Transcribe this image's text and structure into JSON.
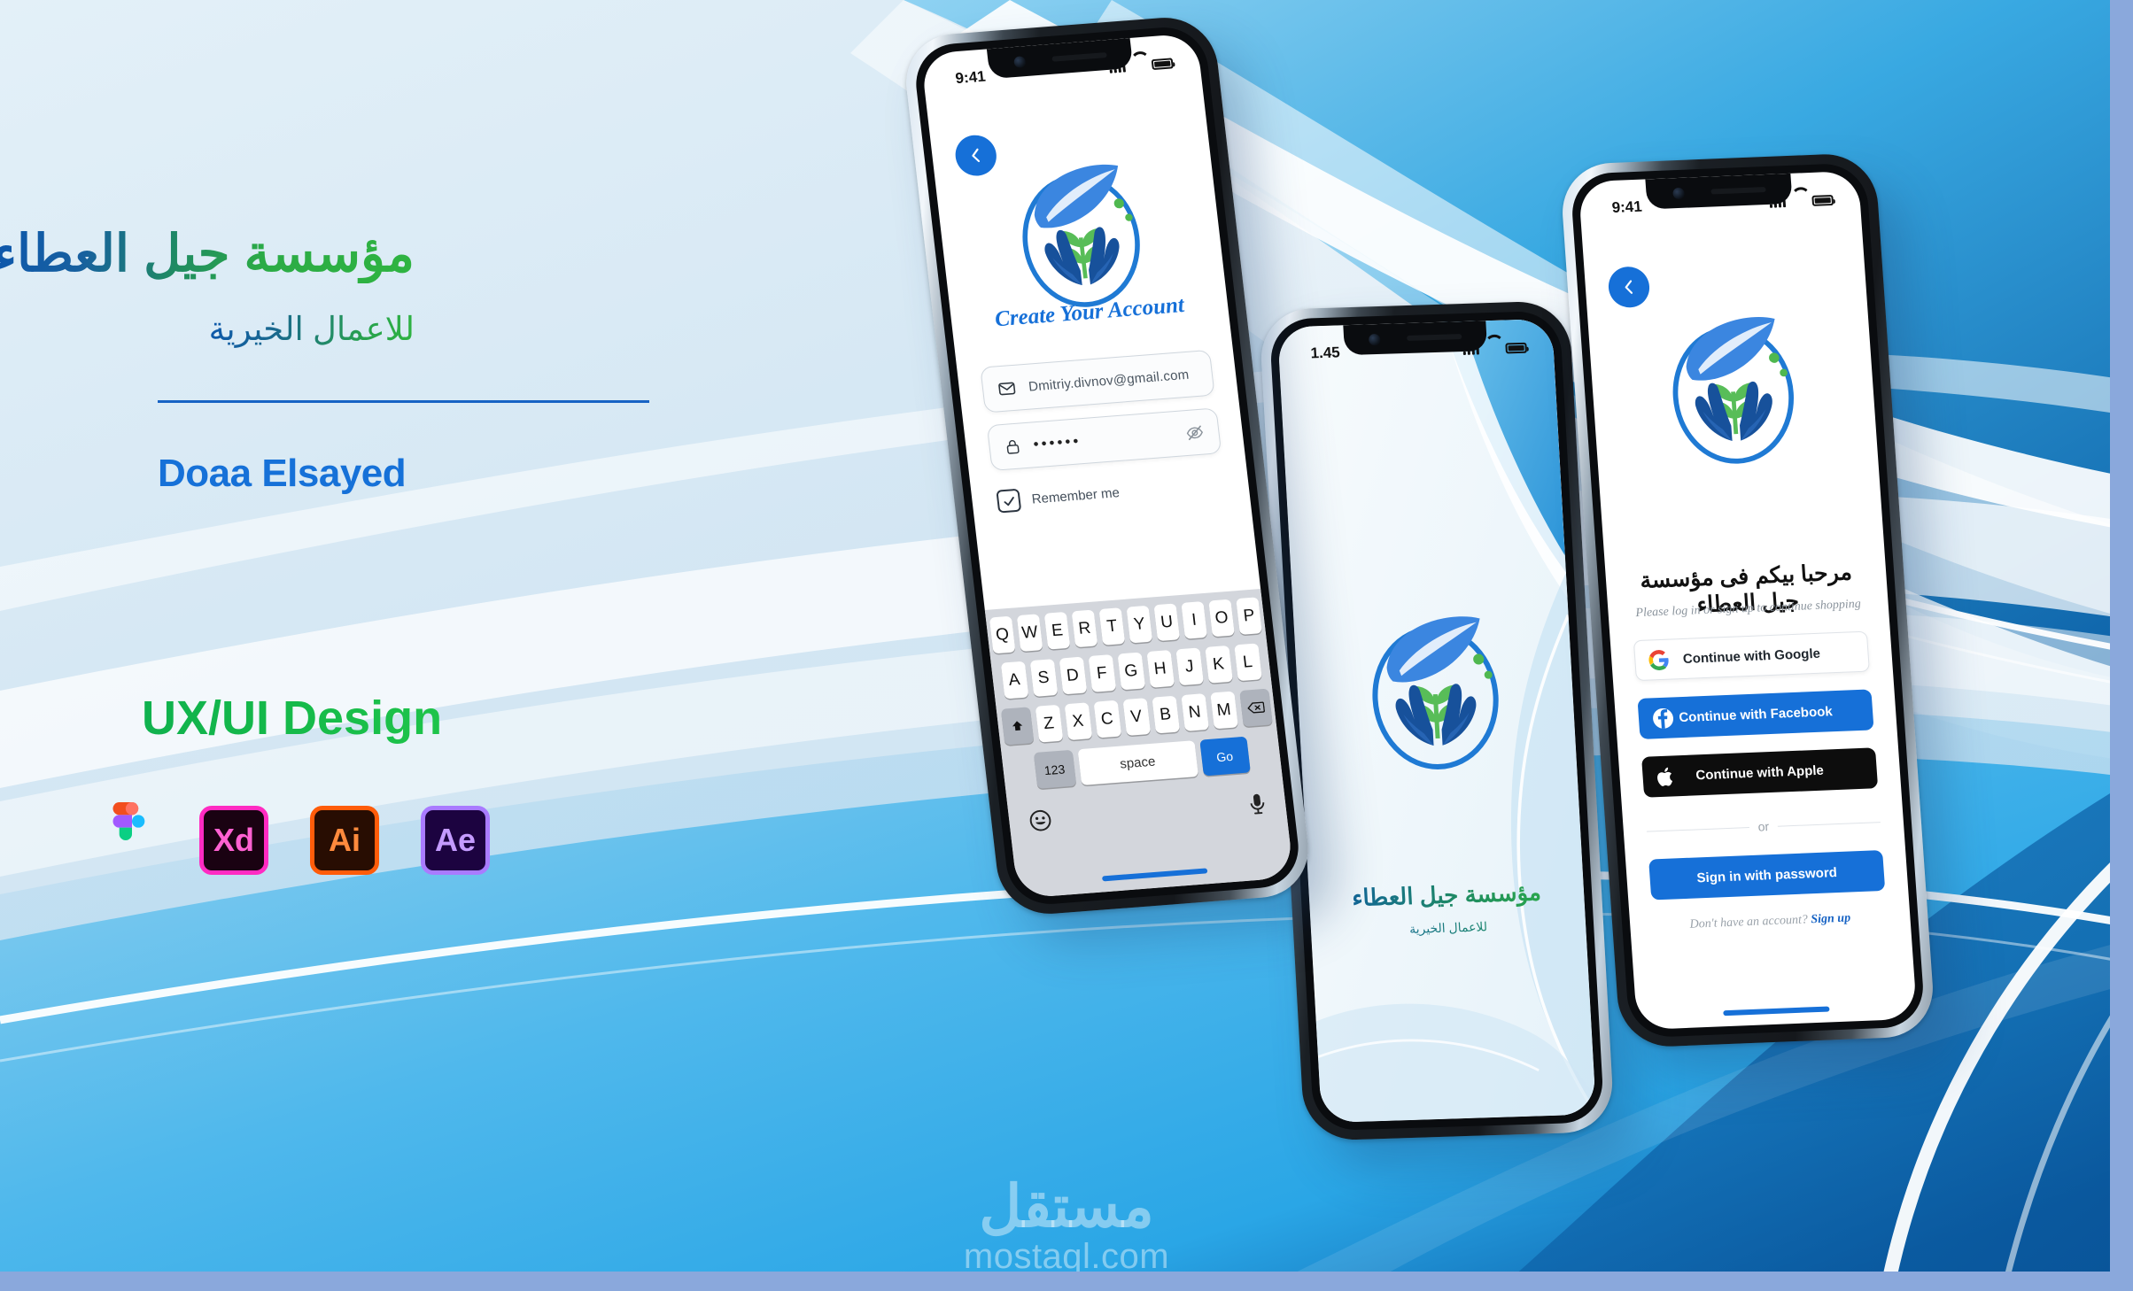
{
  "colors": {
    "brand_blue": "#1670d8",
    "brand_green": "#2fb441",
    "deep_blue": "#0d57ad",
    "bg_light": "#dceaf5",
    "bg_blue": "#47b0e8",
    "frame": "#8aa8dc"
  },
  "left_panel": {
    "org_title": "مؤسسة جيل العطاء",
    "org_subtitle": "للاعمال الخيرية",
    "designer_name": "Doaa Elsayed",
    "role": "UX/UI Design",
    "tools": [
      {
        "name": "figma-icon",
        "label": ""
      },
      {
        "name": "adobe-xd-icon",
        "label": "Xd"
      },
      {
        "name": "adobe-illustrator-icon",
        "label": "Ai"
      },
      {
        "name": "adobe-after-effects-icon",
        "label": "Ae"
      }
    ]
  },
  "phone1": {
    "status": {
      "time": "9:41"
    },
    "title": "Create Your Account",
    "email": {
      "value": "Dmitriy.divnov@gmail.com"
    },
    "password": {
      "value": "••••••"
    },
    "remember": {
      "label": "Remember me",
      "checked": true
    },
    "keyboard": {
      "row1": [
        "Q",
        "W",
        "E",
        "R",
        "T",
        "Y",
        "U",
        "I",
        "O",
        "P"
      ],
      "row2": [
        "A",
        "S",
        "D",
        "F",
        "G",
        "H",
        "J",
        "K",
        "L"
      ],
      "row3": [
        "Z",
        "X",
        "C",
        "V",
        "B",
        "N",
        "M"
      ],
      "num_key": "123",
      "space_key": "space",
      "go_key": "Go"
    }
  },
  "phone2": {
    "status": {
      "time": "1.45"
    },
    "app_name": "مؤسسة جيل العطاء",
    "app_tagline": "للاعمال الخيرية"
  },
  "phone3": {
    "status": {
      "time": "9:41"
    },
    "heading": "مرحبا بيكم فى مؤسسة جيل العطاء",
    "subheading": "Please log in or sign up to continue shopping",
    "buttons": {
      "google": "Continue with Google",
      "facebook": "Continue with Facebook",
      "apple": "Continue with Apple",
      "password": "Sign in with password"
    },
    "divider_label": "or",
    "signup_prompt": "Don't have an account?",
    "signup_link": "Sign up"
  },
  "watermark": {
    "arabic": "مستقل",
    "url": "mostaql.com"
  }
}
